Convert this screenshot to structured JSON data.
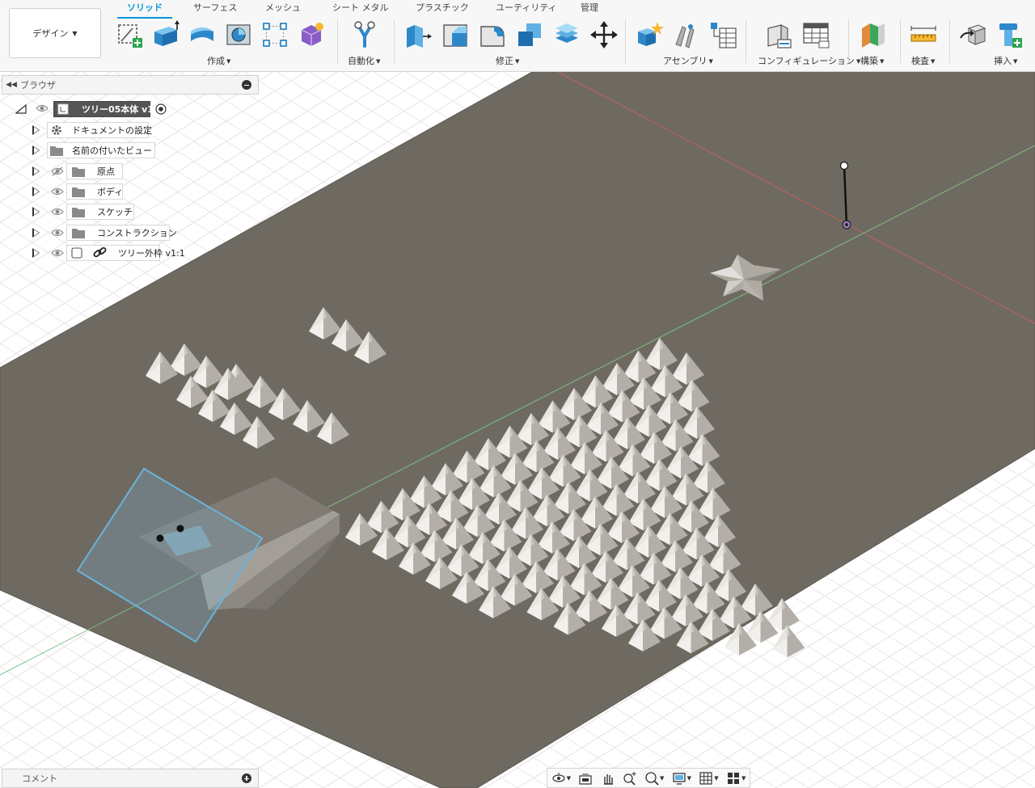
{
  "workspace": {
    "label": "デザイン"
  },
  "tabs": [
    {
      "label": "ソリッド",
      "active": true
    },
    {
      "label": "サーフェス"
    },
    {
      "label": "メッシュ"
    },
    {
      "label": "シート メタル"
    },
    {
      "label": "プラスチック"
    },
    {
      "label": "ユーティリティ"
    },
    {
      "label": "管理"
    }
  ],
  "groups": {
    "create": "作成",
    "automate": "自動化",
    "modify": "修正",
    "assemble": "アセンブリ",
    "configure": "コンフィギュレーション",
    "construct": "構築",
    "inspect": "検査",
    "insert": "挿入"
  },
  "tools": {
    "create": [
      "create-sketch-icon",
      "extrude-icon",
      "revolve-icon",
      "hole-icon",
      "pattern-icon",
      "create-form-icon"
    ],
    "automate": [
      "automate-icon"
    ],
    "modify": [
      "press-pull-icon",
      "fillet-icon",
      "chamfer-icon",
      "combine-icon",
      "shell-icon",
      "move-icon"
    ],
    "assemble": [
      "new-component-icon",
      "joint-icon",
      "bom-icon"
    ],
    "configure": [
      "configure-icon",
      "table-icon"
    ],
    "construct": [
      "offset-plane-icon"
    ],
    "inspect": [
      "measure-icon"
    ],
    "insert": [
      "insert-derive-icon",
      "insert-mcmaster-icon"
    ]
  },
  "browser": {
    "title": "ブラウザ",
    "root": {
      "label": "ツリー05本体 v1"
    },
    "items": [
      {
        "label": "ドキュメントの設定",
        "icon": "gear-icon",
        "visibility": "none"
      },
      {
        "label": "名前の付いたビュー",
        "icon": "folder-icon",
        "visibility": "none"
      },
      {
        "label": "原点",
        "icon": "folder-icon",
        "visibility": "hidden"
      },
      {
        "label": "ボディ",
        "icon": "folder-icon",
        "visibility": "visible"
      },
      {
        "label": "スケッチ",
        "icon": "folder-icon",
        "visibility": "visible"
      },
      {
        "label": "コンストラクション",
        "icon": "folder-icon",
        "visibility": "visible"
      },
      {
        "label": "ツリー外枠 v1:1",
        "icon": "component-link-icon",
        "visibility": "visible"
      }
    ]
  },
  "comments": {
    "title": "コメント"
  },
  "nav_tools": [
    "orbit-icon",
    "look-at-icon",
    "pan-icon",
    "zoom-icon",
    "fit-icon",
    "display-settings-icon",
    "grid-icon",
    "viewports-icon"
  ],
  "colors": {
    "accent": "#0696d7",
    "plate": "#6f6a61",
    "grid": "#dcdcdc",
    "selection": "#6ab4dc"
  }
}
